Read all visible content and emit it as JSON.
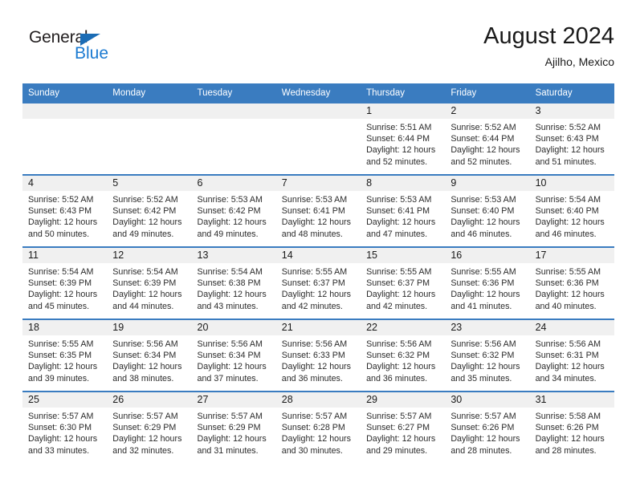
{
  "brand": {
    "name_dark": "General",
    "name_blue": "Blue",
    "logo_icon": "triangle-icon",
    "accent_color": "#1b7ad1",
    "header_color": "#3a7cc0"
  },
  "header": {
    "title": "August 2024",
    "subtitle": "Ajilho, Mexico"
  },
  "calendar": {
    "weekday_headers": [
      "Sunday",
      "Monday",
      "Tuesday",
      "Wednesday",
      "Thursday",
      "Friday",
      "Saturday"
    ],
    "weeks": [
      [
        {
          "day": "",
          "lines": []
        },
        {
          "day": "",
          "lines": []
        },
        {
          "day": "",
          "lines": []
        },
        {
          "day": "",
          "lines": []
        },
        {
          "day": "1",
          "lines": [
            "Sunrise: 5:51 AM",
            "Sunset: 6:44 PM",
            "Daylight: 12 hours",
            "and 52 minutes."
          ]
        },
        {
          "day": "2",
          "lines": [
            "Sunrise: 5:52 AM",
            "Sunset: 6:44 PM",
            "Daylight: 12 hours",
            "and 52 minutes."
          ]
        },
        {
          "day": "3",
          "lines": [
            "Sunrise: 5:52 AM",
            "Sunset: 6:43 PM",
            "Daylight: 12 hours",
            "and 51 minutes."
          ]
        }
      ],
      [
        {
          "day": "4",
          "lines": [
            "Sunrise: 5:52 AM",
            "Sunset: 6:43 PM",
            "Daylight: 12 hours",
            "and 50 minutes."
          ]
        },
        {
          "day": "5",
          "lines": [
            "Sunrise: 5:52 AM",
            "Sunset: 6:42 PM",
            "Daylight: 12 hours",
            "and 49 minutes."
          ]
        },
        {
          "day": "6",
          "lines": [
            "Sunrise: 5:53 AM",
            "Sunset: 6:42 PM",
            "Daylight: 12 hours",
            "and 49 minutes."
          ]
        },
        {
          "day": "7",
          "lines": [
            "Sunrise: 5:53 AM",
            "Sunset: 6:41 PM",
            "Daylight: 12 hours",
            "and 48 minutes."
          ]
        },
        {
          "day": "8",
          "lines": [
            "Sunrise: 5:53 AM",
            "Sunset: 6:41 PM",
            "Daylight: 12 hours",
            "and 47 minutes."
          ]
        },
        {
          "day": "9",
          "lines": [
            "Sunrise: 5:53 AM",
            "Sunset: 6:40 PM",
            "Daylight: 12 hours",
            "and 46 minutes."
          ]
        },
        {
          "day": "10",
          "lines": [
            "Sunrise: 5:54 AM",
            "Sunset: 6:40 PM",
            "Daylight: 12 hours",
            "and 46 minutes."
          ]
        }
      ],
      [
        {
          "day": "11",
          "lines": [
            "Sunrise: 5:54 AM",
            "Sunset: 6:39 PM",
            "Daylight: 12 hours",
            "and 45 minutes."
          ]
        },
        {
          "day": "12",
          "lines": [
            "Sunrise: 5:54 AM",
            "Sunset: 6:39 PM",
            "Daylight: 12 hours",
            "and 44 minutes."
          ]
        },
        {
          "day": "13",
          "lines": [
            "Sunrise: 5:54 AM",
            "Sunset: 6:38 PM",
            "Daylight: 12 hours",
            "and 43 minutes."
          ]
        },
        {
          "day": "14",
          "lines": [
            "Sunrise: 5:55 AM",
            "Sunset: 6:37 PM",
            "Daylight: 12 hours",
            "and 42 minutes."
          ]
        },
        {
          "day": "15",
          "lines": [
            "Sunrise: 5:55 AM",
            "Sunset: 6:37 PM",
            "Daylight: 12 hours",
            "and 42 minutes."
          ]
        },
        {
          "day": "16",
          "lines": [
            "Sunrise: 5:55 AM",
            "Sunset: 6:36 PM",
            "Daylight: 12 hours",
            "and 41 minutes."
          ]
        },
        {
          "day": "17",
          "lines": [
            "Sunrise: 5:55 AM",
            "Sunset: 6:36 PM",
            "Daylight: 12 hours",
            "and 40 minutes."
          ]
        }
      ],
      [
        {
          "day": "18",
          "lines": [
            "Sunrise: 5:55 AM",
            "Sunset: 6:35 PM",
            "Daylight: 12 hours",
            "and 39 minutes."
          ]
        },
        {
          "day": "19",
          "lines": [
            "Sunrise: 5:56 AM",
            "Sunset: 6:34 PM",
            "Daylight: 12 hours",
            "and 38 minutes."
          ]
        },
        {
          "day": "20",
          "lines": [
            "Sunrise: 5:56 AM",
            "Sunset: 6:34 PM",
            "Daylight: 12 hours",
            "and 37 minutes."
          ]
        },
        {
          "day": "21",
          "lines": [
            "Sunrise: 5:56 AM",
            "Sunset: 6:33 PM",
            "Daylight: 12 hours",
            "and 36 minutes."
          ]
        },
        {
          "day": "22",
          "lines": [
            "Sunrise: 5:56 AM",
            "Sunset: 6:32 PM",
            "Daylight: 12 hours",
            "and 36 minutes."
          ]
        },
        {
          "day": "23",
          "lines": [
            "Sunrise: 5:56 AM",
            "Sunset: 6:32 PM",
            "Daylight: 12 hours",
            "and 35 minutes."
          ]
        },
        {
          "day": "24",
          "lines": [
            "Sunrise: 5:56 AM",
            "Sunset: 6:31 PM",
            "Daylight: 12 hours",
            "and 34 minutes."
          ]
        }
      ],
      [
        {
          "day": "25",
          "lines": [
            "Sunrise: 5:57 AM",
            "Sunset: 6:30 PM",
            "Daylight: 12 hours",
            "and 33 minutes."
          ]
        },
        {
          "day": "26",
          "lines": [
            "Sunrise: 5:57 AM",
            "Sunset: 6:29 PM",
            "Daylight: 12 hours",
            "and 32 minutes."
          ]
        },
        {
          "day": "27",
          "lines": [
            "Sunrise: 5:57 AM",
            "Sunset: 6:29 PM",
            "Daylight: 12 hours",
            "and 31 minutes."
          ]
        },
        {
          "day": "28",
          "lines": [
            "Sunrise: 5:57 AM",
            "Sunset: 6:28 PM",
            "Daylight: 12 hours",
            "and 30 minutes."
          ]
        },
        {
          "day": "29",
          "lines": [
            "Sunrise: 5:57 AM",
            "Sunset: 6:27 PM",
            "Daylight: 12 hours",
            "and 29 minutes."
          ]
        },
        {
          "day": "30",
          "lines": [
            "Sunrise: 5:57 AM",
            "Sunset: 6:26 PM",
            "Daylight: 12 hours",
            "and 28 minutes."
          ]
        },
        {
          "day": "31",
          "lines": [
            "Sunrise: 5:58 AM",
            "Sunset: 6:26 PM",
            "Daylight: 12 hours",
            "and 28 minutes."
          ]
        }
      ]
    ]
  }
}
